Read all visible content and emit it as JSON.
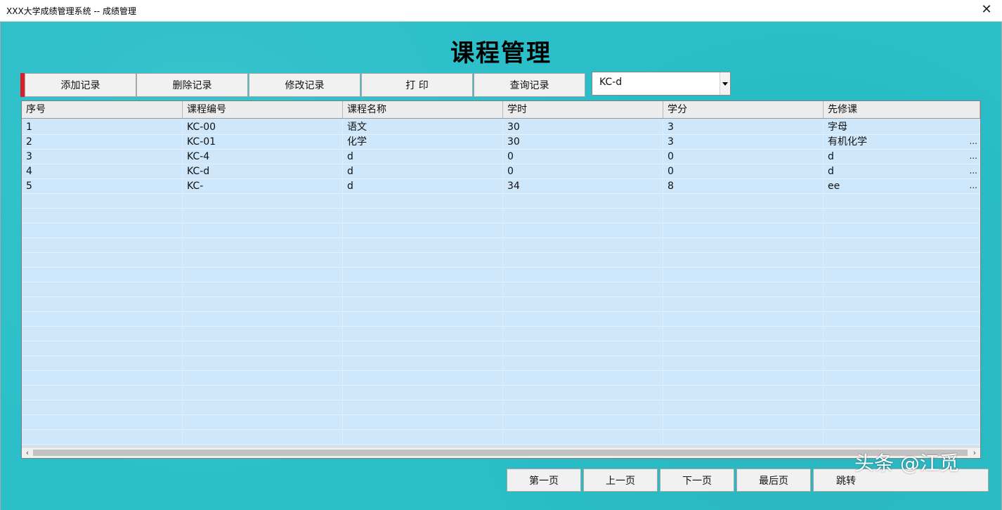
{
  "window": {
    "title": "XXX大学成绩管理系统 -- 成绩管理",
    "close_symbol": "✕"
  },
  "page_title": "课程管理",
  "toolbar": {
    "buttons": [
      "添加记录",
      "删除记录",
      "修改记录",
      "打 印",
      "查询记录"
    ],
    "accent_color": "#d91e2a"
  },
  "search": {
    "value": "KC-d"
  },
  "table": {
    "columns": [
      "序号",
      "课程编号",
      "课程名称",
      "学时",
      "学分",
      "先修课"
    ],
    "rows": [
      [
        "1",
        "KC-00",
        "语文",
        "30",
        "3",
        "字母"
      ],
      [
        "2",
        "KC-01",
        "化学",
        "30",
        "3",
        "有机化学"
      ],
      [
        "3",
        "KC-4",
        "d",
        "0",
        "0",
        "d"
      ],
      [
        "4",
        "KC-d",
        "d",
        "0",
        "0",
        "d"
      ],
      [
        "5",
        "KC-",
        "d",
        "34",
        "8",
        "ee"
      ]
    ],
    "ellipsis_rows": [
      1,
      2,
      3,
      4
    ],
    "ellipsis": "...",
    "scroll_left": "‹",
    "scroll_right": "›"
  },
  "pagination": {
    "buttons": [
      "第一页",
      "上一页",
      "下一页",
      "最后页",
      "跳转"
    ]
  },
  "watermark": "头条 @江觅",
  "colors": {
    "background": "#2bbfc9",
    "grid": "#cfe7fb"
  }
}
